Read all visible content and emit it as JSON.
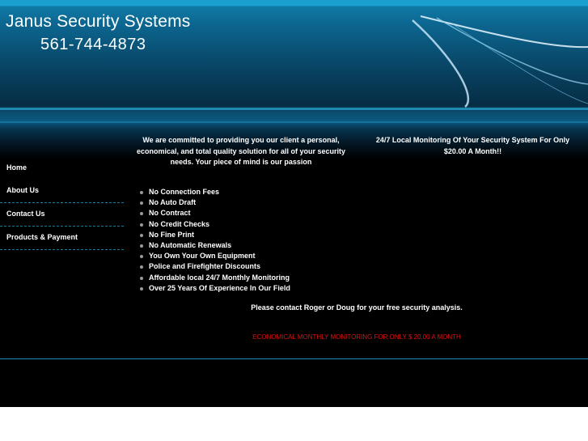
{
  "header": {
    "title": "Janus Security Systems",
    "phone": "561-744-4873"
  },
  "nav": {
    "items": [
      {
        "label": "Home"
      },
      {
        "label": "About Us"
      },
      {
        "label": "Contact Us"
      },
      {
        "label": "Products & Payment"
      }
    ]
  },
  "content": {
    "mission": "We are committed to providing you our client a personal, economical, and total quality solution for all of your security needs. Your piece of mind is our passion",
    "promo": "24/7 Local Monitoring Of Your Security System For Only $20.00 A Month!!",
    "features": [
      "No Connection Fees",
      "No Auto Draft",
      "No Contract",
      "No Credit Checks",
      "No Fine Print",
      "No Automatic Renewals",
      "You Own Your Own Equipment",
      "Police and Firefighter Discounts",
      "Affordable local 24/7 Monthly Monitoring",
      "Over 25 Years Of Experience In Our Field"
    ],
    "contact_text": "Please contact Roger or Doug for your free security analysis.",
    "banner": "ECONOMICAL MONTHLY MONITORING FOR ONLY $ 20.00 A MONTH"
  },
  "colors": {
    "header_top": "#1aa0cf",
    "background": "#000000",
    "accent_line": "#1f8fbd",
    "banner_text": "#e01010"
  }
}
